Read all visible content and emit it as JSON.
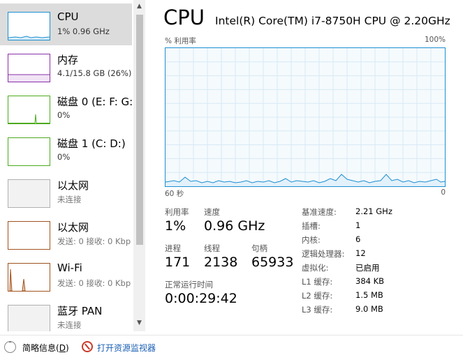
{
  "sidebar": {
    "items": [
      {
        "title": "CPU",
        "sub": "1% 0.96 GHz",
        "color": "#1b8fd0"
      },
      {
        "title": "内存",
        "sub": "4.1/15.8 GB (26%)",
        "color": "#8b2fa8"
      },
      {
        "title": "磁盘 0 (E: F: G:",
        "sub": "0%",
        "color": "#4caa1e"
      },
      {
        "title": "磁盘 1 (C: D:)",
        "sub": "0%",
        "color": "#4caa1e"
      },
      {
        "title": "以太网",
        "sub": "未连接",
        "color": "#b0b0b0"
      },
      {
        "title": "以太网",
        "sub": "发送: 0 接收: 0 Kbp",
        "color": "#a0521e"
      },
      {
        "title": "Wi-Fi",
        "sub": "发送: 0 接收: 0 Kbp",
        "color": "#a0521e"
      },
      {
        "title": "蓝牙 PAN",
        "sub": "未连接",
        "color": "#b0b0b0"
      }
    ]
  },
  "main": {
    "heading": "CPU",
    "model": "Intel(R) Core(TM) i7-8750H CPU @ 2.20GHz",
    "util_label": "% 利用率",
    "util_max": "100%",
    "time_label": "60 秒",
    "time_min": "0",
    "accent": "#1b8fd0"
  },
  "stats": {
    "utilization": {
      "label": "利用率",
      "value": "1%"
    },
    "speed": {
      "label": "速度",
      "value": "0.96 GHz"
    },
    "processes": {
      "label": "进程",
      "value": "171"
    },
    "threads": {
      "label": "线程",
      "value": "2138"
    },
    "handles": {
      "label": "句柄",
      "value": "65933"
    },
    "uptime": {
      "label": "正常运行时间",
      "value": "0:00:29:42"
    }
  },
  "specs": [
    {
      "label": "基准速度:",
      "value": "2.21 GHz"
    },
    {
      "label": "插槽:",
      "value": "1"
    },
    {
      "label": "内核:",
      "value": "6"
    },
    {
      "label": "逻辑处理器:",
      "value": "12"
    },
    {
      "label": "虚拟化:",
      "value": "已启用"
    },
    {
      "label": "L1 缓存:",
      "value": "384 KB"
    },
    {
      "label": "L2 缓存:",
      "value": "1.5 MB"
    },
    {
      "label": "L3 缓存:",
      "value": "9.0 MB"
    }
  ],
  "footer": {
    "brief_label": "简略信息(",
    "brief_key": "D",
    "brief_end": ")",
    "monitor_label": "打开资源监视器"
  }
}
